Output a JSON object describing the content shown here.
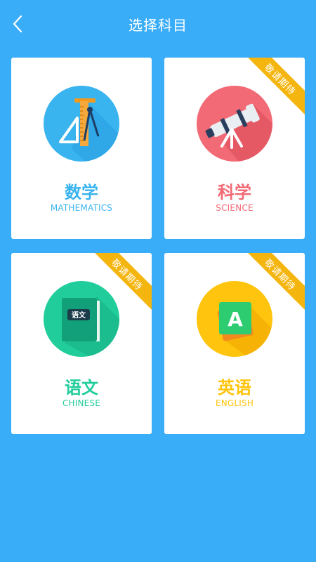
{
  "header": {
    "title": "选择科目"
  },
  "subjects": [
    {
      "name": "数学",
      "en": "MATHEMATICS",
      "color": "#3ab4ef",
      "ribbon": ""
    },
    {
      "name": "科学",
      "en": "SCIENCE",
      "color": "#f26a75",
      "ribbon": "敬请期待"
    },
    {
      "name": "语文",
      "en": "CHINESE",
      "color": "#21cd9b",
      "ribbon": "敬请期待",
      "book_label": "语文"
    },
    {
      "name": "英语",
      "en": "ENGLISH",
      "color": "#ffc40d",
      "ribbon": "敬请期待",
      "tile_letter": "A"
    }
  ],
  "icons": [
    "back-chevron-icon",
    "ruler-compass-icon",
    "telescope-icon",
    "book-icon",
    "letter-a-icon"
  ]
}
